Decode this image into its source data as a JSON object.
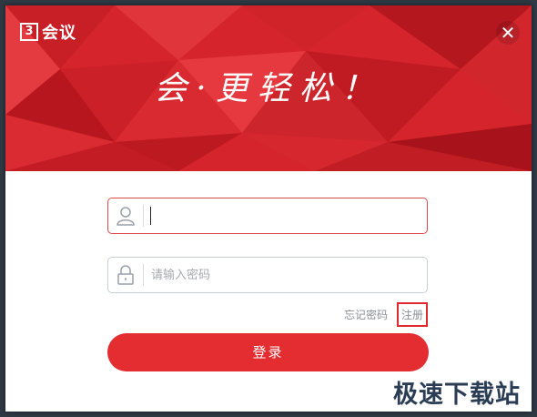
{
  "app": {
    "logo_mark": "3",
    "logo_text": "会议",
    "slogan": "会·更轻松！"
  },
  "form": {
    "username_placeholder": "",
    "password_placeholder": "请输入密码",
    "forgot_label": "忘记密码",
    "register_label": "注册",
    "login_label": "登录"
  },
  "icons": {
    "close": "close-icon",
    "user": "user-icon",
    "lock": "lock-icon"
  },
  "colors": {
    "brand_red": "#e32d31",
    "header_red": "#d6242c",
    "highlight_border": "#e0282e"
  },
  "watermark": "极速下载站"
}
